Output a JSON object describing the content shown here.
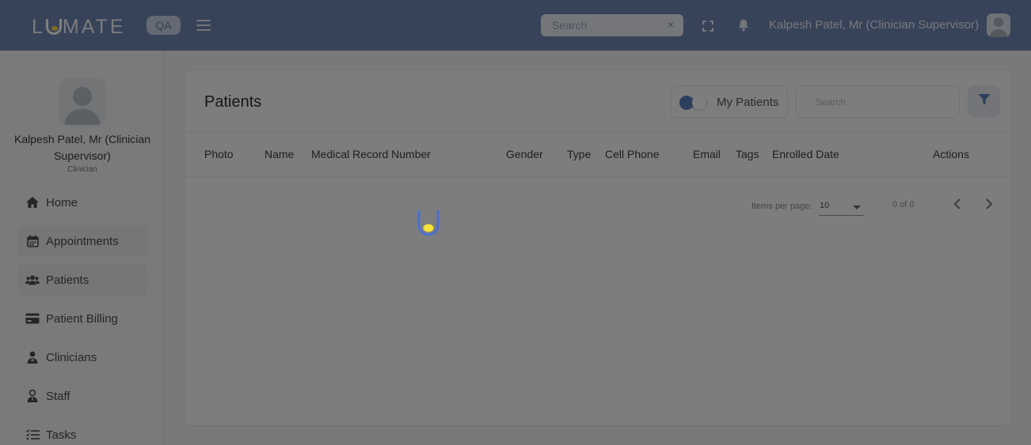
{
  "header": {
    "logo_text_left": "L",
    "logo_text_right": "MATE",
    "environment_badge": "QA",
    "search_placeholder": "Search",
    "clear_symbol": "×",
    "user_display_name": "Kalpesh Patel, Mr (Clinician Supervisor)"
  },
  "sidebar": {
    "profile_name": "Kalpesh Patel, Mr (Clinician Supervisor)",
    "profile_role": "Clinician",
    "items": [
      {
        "label": "Home",
        "icon": "home-icon"
      },
      {
        "label": "Appointments",
        "icon": "calendar-icon"
      },
      {
        "label": "Patients",
        "icon": "users-icon"
      },
      {
        "label": "Patient Billing",
        "icon": "credit-card-icon"
      },
      {
        "label": "Clinicians",
        "icon": "user-doctor-icon"
      },
      {
        "label": "Staff",
        "icon": "user-tie-icon"
      },
      {
        "label": "Tasks",
        "icon": "task-list-icon"
      }
    ]
  },
  "main": {
    "title": "Patients",
    "my_patients_label": "My Patients",
    "my_patients_toggle_on": true,
    "search_placeholder": "Search",
    "columns": [
      "Photo",
      "Name",
      "Medical Record Number",
      "Gender",
      "Type",
      "Cell Phone",
      "Email",
      "Tags",
      "Enrolled Date",
      "Actions"
    ],
    "rows": [],
    "paginator": {
      "items_per_page_label": "Items per page:",
      "items_per_page_value": "10",
      "range_label": "0 of 0"
    }
  },
  "loading": true,
  "colors": {
    "topbar": "#6f87b3",
    "accent": "#5b7fbd",
    "loader_blue": "#4a6fd0",
    "loader_yellow": "#f5e23a"
  }
}
